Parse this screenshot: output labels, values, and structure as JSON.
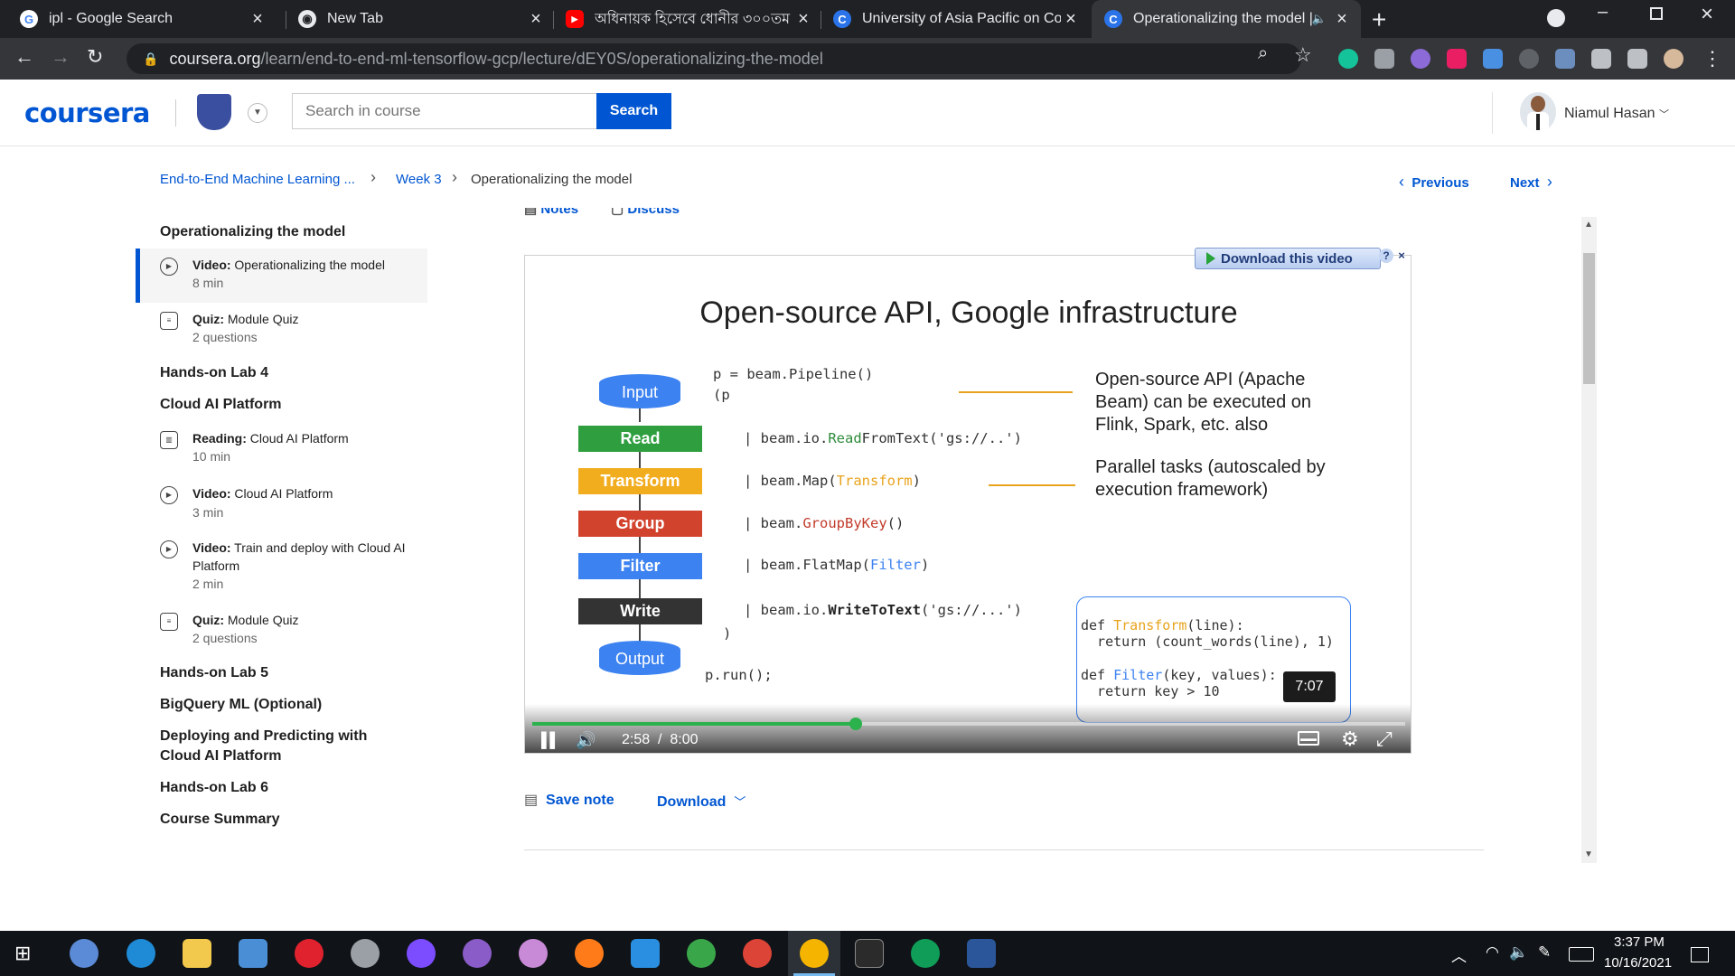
{
  "browser": {
    "tabs": [
      {
        "title": "ipl - Google Search",
        "favicon": "google-icon"
      },
      {
        "title": "New Tab",
        "favicon": "chrome-icon"
      },
      {
        "title": "অধিনায়ক হিসেবে ধোনীর ৩০০তম",
        "favicon": "youtube-icon"
      },
      {
        "title": "University of Asia Pacific on Cour",
        "favicon": "coursera-icon"
      },
      {
        "title": "Operationalizing the model |",
        "favicon": "coursera-icon",
        "active": true
      }
    ],
    "url_host": "coursera.org",
    "url_path": "/learn/end-to-end-ml-tensorflow-gcp/lecture/dEY0S/operationalizing-the-model"
  },
  "header": {
    "logo": "coursera",
    "search_placeholder": "Search in course",
    "search_button": "Search",
    "user_name": "Niamul Hasan"
  },
  "breadcrumb": {
    "course": "End-to-End Machine Learning ...",
    "week": "Week 3",
    "current": "Operationalizing the model",
    "previous": "Previous",
    "next": "Next"
  },
  "sidebar": {
    "section1": "Operationalizing the model",
    "item1_type": "Video:",
    "item1_title": "Operationalizing the model",
    "item1_meta": "8 min",
    "item2_type": "Quiz:",
    "item2_title": "Module Quiz",
    "item2_meta": "2 questions",
    "section2": "Hands-on Lab 4",
    "section3": "Cloud AI Platform",
    "item3_type": "Reading:",
    "item3_title": "Cloud AI Platform",
    "item3_meta": "10 min",
    "item4_type": "Video:",
    "item4_title": "Cloud AI Platform",
    "item4_meta": "3 min",
    "item5_type": "Video:",
    "item5_title": "Train and deploy with Cloud AI Platform",
    "item5_meta": "2 min",
    "item6_type": "Quiz:",
    "item6_title": "Module Quiz",
    "item6_meta": "2 questions",
    "section4": "Hands-on Lab 5",
    "section5": "BigQuery ML (Optional)",
    "section6": "Deploying and Predicting with Cloud AI Platform",
    "section7": "Hands-on Lab 6",
    "section8": "Course Summary"
  },
  "content_tabs": {
    "notes": "Notes",
    "discuss": "Discuss"
  },
  "video": {
    "download_badge": "Download this video",
    "slide_title": "Open-source API, Google infrastructure",
    "stages": {
      "input": "Input",
      "read": "Read",
      "transform": "Transform",
      "group": "Group",
      "filter": "Filter",
      "write": "Write",
      "output": "Output"
    },
    "code": {
      "l1": "p = beam.Pipeline()",
      "l2": "(p",
      "l3_pre": "| beam.io.",
      "l3_kw": "Read",
      "l3_post": "FromText('gs://..')",
      "l4_pre": "| beam.Map(",
      "l4_kw": "Transform",
      "l4_post": ")",
      "l5_pre": "| beam.",
      "l5_kw": "GroupByKey",
      "l5_post": "()",
      "l6_pre": "| beam.FlatMap(",
      "l6_kw": "Filter",
      "l6_post": ")",
      "l7_pre": "| beam.io.",
      "l7_kw": "WriteToText",
      "l7_post": "('gs://...')",
      "l8": ")",
      "l9": "p.run();",
      "d1_pre": "def ",
      "d1_kw": "Transform",
      "d1_post": "(line):",
      "d2": "  return (count_words(line), 1)",
      "d3_pre": "def ",
      "d3_kw": "Filter",
      "d3_post": "(key, values):",
      "d4": "  return key > 10"
    },
    "note1": "Open-source API (Apache Beam) can be executed on Flink, Spark, etc. also",
    "note2": "Parallel tasks (autoscaled by execution framework)",
    "hover_time": "7:07",
    "current_time": "2:58",
    "time_sep": "/",
    "duration": "8:00",
    "progress": 0.371
  },
  "below_video": {
    "save_note": "Save note",
    "download": "Download"
  },
  "taskbar": {
    "time": "3:37 PM",
    "date": "10/16/2021"
  },
  "colors": {
    "accent": "#0056d2",
    "read": "#2e9e3f",
    "transform": "#f2ad1f",
    "group": "#d2432e",
    "filter": "#3c82f0",
    "write": "#333333",
    "progress": "#2bb24c"
  }
}
